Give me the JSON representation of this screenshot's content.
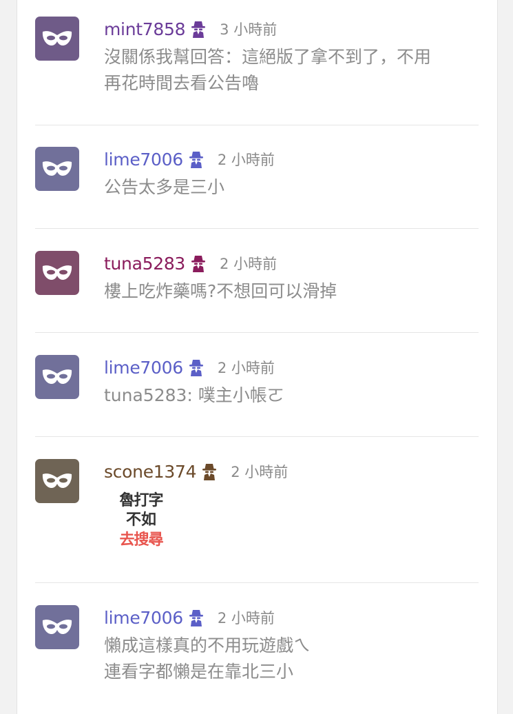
{
  "comments": [
    {
      "username": "mint7858",
      "user_color": "#6b3c99",
      "avatar_color": "#6f5b88",
      "time": "3 小時前",
      "lines": [
        "沒關係我幫回答：這絕版了拿不到了，不用",
        "再花時間去看公告嚕"
      ]
    },
    {
      "username": "lime7006",
      "user_color": "#5b5fc7",
      "avatar_color": "#71709a",
      "time": "2 小時前",
      "lines": [
        "公告太多是三小"
      ]
    },
    {
      "username": "tuna5283",
      "user_color": "#8a1c5c",
      "avatar_color": "#7f4d6a",
      "time": "2 小時前",
      "lines": [
        "樓上吃炸藥嗎?不想回可以滑掉"
      ]
    },
    {
      "username": "lime7006",
      "user_color": "#5b5fc7",
      "avatar_color": "#71709a",
      "time": "2 小時前",
      "lines": [
        "tuna5283: 噗主小帳ㄛ"
      ]
    },
    {
      "username": "scone1374",
      "user_color": "#6b4a2a",
      "avatar_color": "#6f6455",
      "time": "2 小時前",
      "sticker": [
        "魯打字",
        "不如",
        "去搜尋"
      ]
    },
    {
      "username": "lime7006",
      "user_color": "#5b5fc7",
      "avatar_color": "#71709a",
      "time": "2 小時前",
      "lines": [
        "懶成這樣真的不用玩遊戲ㄟ",
        "連看字都懶是在靠北三小"
      ]
    }
  ],
  "icons": {
    "avatar": "anonymous-mask-icon",
    "badge": "spy-icon"
  }
}
